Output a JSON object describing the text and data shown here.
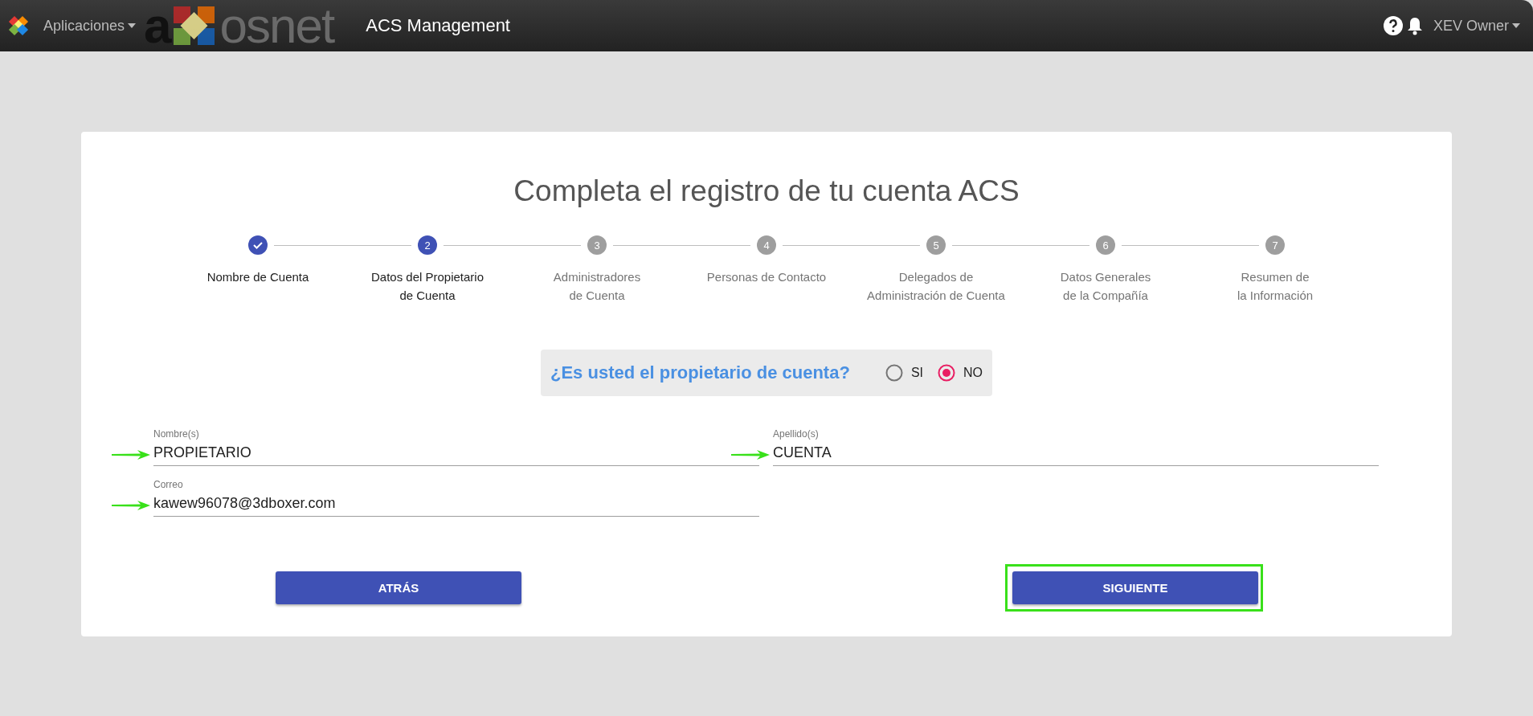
{
  "navbar": {
    "apps_menu": "Aplicaciones",
    "brand": {
      "before": "a",
      "after": "osnet"
    },
    "title": "ACS Management",
    "user_menu": "XEV Owner"
  },
  "card": {
    "title": "Completa el registro de tu cuenta ACS",
    "steps": [
      {
        "label": "Nombre de Cuenta",
        "completed": true,
        "selected": false
      },
      {
        "number": "2",
        "label": "Datos del Propietario de Cuenta",
        "completed": false,
        "selected": true
      },
      {
        "number": "3",
        "label": "Administradores de Cuenta",
        "completed": false,
        "selected": false
      },
      {
        "number": "4",
        "label": "Personas de Contacto",
        "completed": false,
        "selected": false
      },
      {
        "number": "5",
        "label": "Delegados de Administración de Cuenta",
        "completed": false,
        "selected": false
      },
      {
        "number": "6",
        "label": "Datos Generales de la Compañía",
        "completed": false,
        "selected": false
      },
      {
        "number": "7",
        "label": "Resumen de la Información",
        "completed": false,
        "selected": false
      }
    ],
    "question": {
      "text": "¿Es usted el propietario de cuenta?",
      "options": [
        {
          "label": "SI",
          "selected": false
        },
        {
          "label": "NO",
          "selected": true
        }
      ]
    },
    "fields": [
      {
        "label": "Nombre(s)",
        "value": "PROPIETARIO",
        "arrow": true
      },
      {
        "label": "Apellido(s)",
        "value": "CUENTA",
        "arrow": true
      },
      {
        "label": "Correo",
        "value": "kawew96078@3dboxer.com",
        "arrow": true
      }
    ],
    "buttons": [
      {
        "label": "ATRÁS",
        "highlighted": false
      },
      {
        "label": "SIGUIENTE",
        "highlighted": true
      }
    ]
  }
}
